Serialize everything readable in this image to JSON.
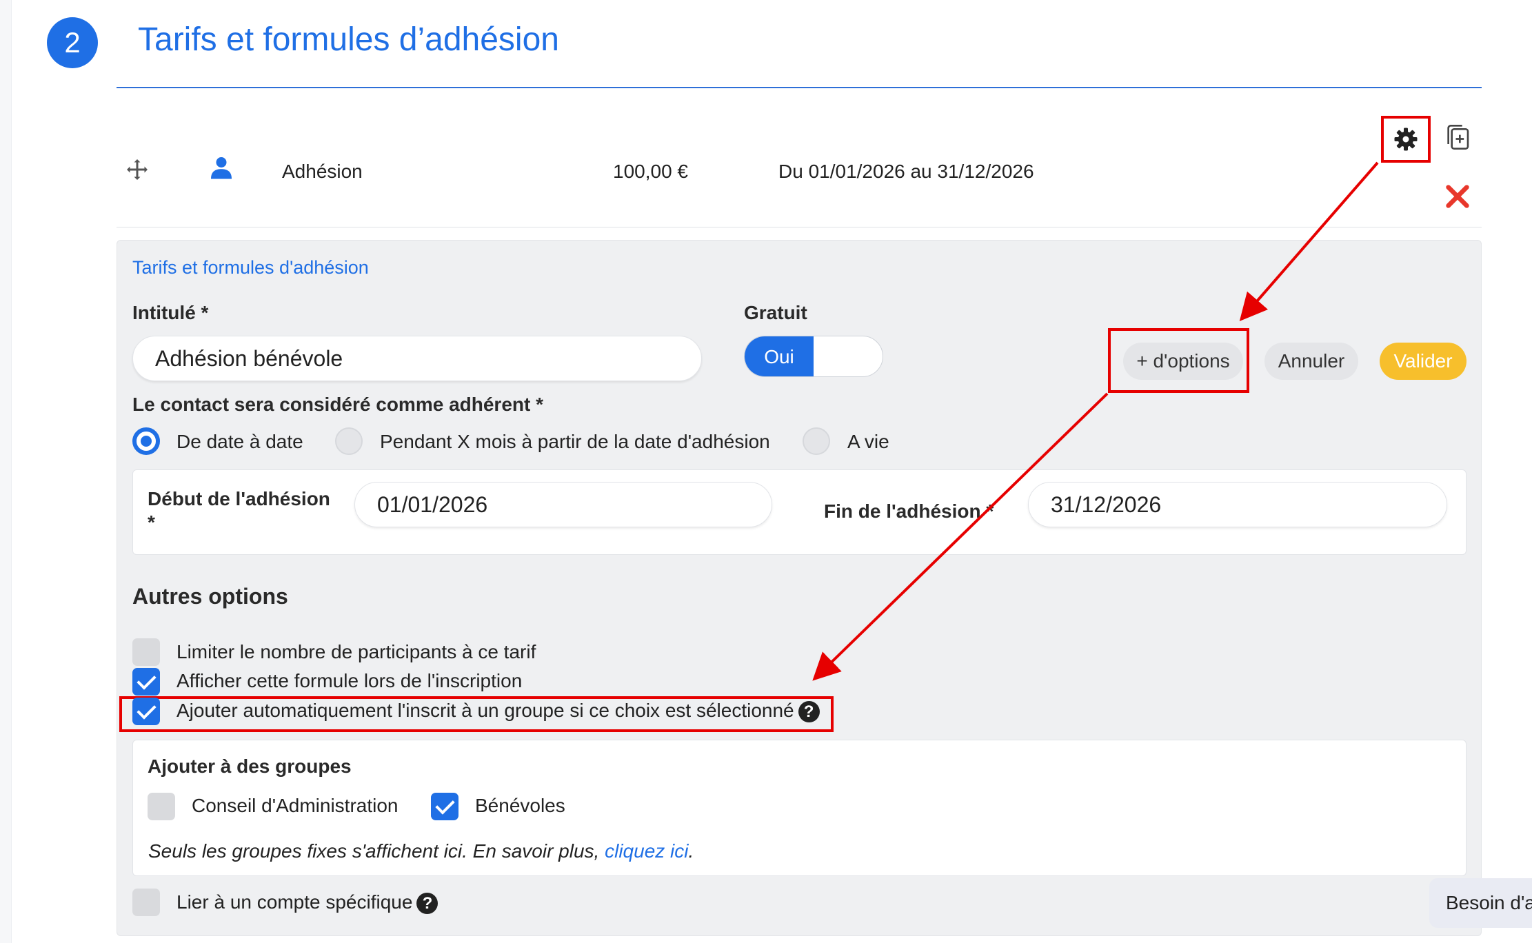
{
  "step": {
    "number": "2",
    "title": "Tarifs et formules d’adhésion"
  },
  "tariff_row": {
    "name": "Adhésion",
    "price": "100,00 €",
    "period": "Du 01/01/2026 au 31/12/2026"
  },
  "panel": {
    "title": "Tarifs et formules d'adhésion",
    "intitule_label": "Intitulé *",
    "intitule_value": "Adhésion bénévole",
    "gratuit_label": "Gratuit",
    "gratuit_toggle": "Oui",
    "buttons": {
      "more_options": "+ d'options",
      "cancel": "Annuler",
      "validate": "Valider"
    },
    "membership_label": "Le contact sera considéré comme adhérent *",
    "membership_options": [
      "De date à date",
      "Pendant X mois à partir de la date d'adhésion",
      "A vie"
    ],
    "membership_selected": "De date à date",
    "start_label": "Début de l'adhésion",
    "start_required": "*",
    "start_value": "01/01/2026",
    "end_label": "Fin de l'adhésion *",
    "end_value": "31/12/2026",
    "other_options_title": "Autres options",
    "options": [
      {
        "label": "Limiter le nombre de participants à ce tarif",
        "checked": false
      },
      {
        "label": "Afficher cette formule lors de l'inscription",
        "checked": true
      },
      {
        "label": "Ajouter automatiquement l'inscrit à un groupe si ce choix est sélectionné",
        "checked": true
      }
    ],
    "groups": {
      "title": "Ajouter à des groupes",
      "items": [
        {
          "label": "Conseil d'Administration",
          "checked": false
        },
        {
          "label": "Bénévoles",
          "checked": true
        }
      ],
      "note": "Seuls les groupes fixes s'affichent ici. En savoir plus, ",
      "note_link": "cliquez ici",
      "note_end": "."
    },
    "link_account": {
      "label": "Lier à un compte spécifique",
      "checked": false
    }
  },
  "help_tab": "Besoin d'a",
  "help_glyph": "?",
  "colors": {
    "accent": "#1f6fe5",
    "highlight": "#e60000",
    "validate": "#f7bf2c",
    "delete": "#e8372b"
  }
}
